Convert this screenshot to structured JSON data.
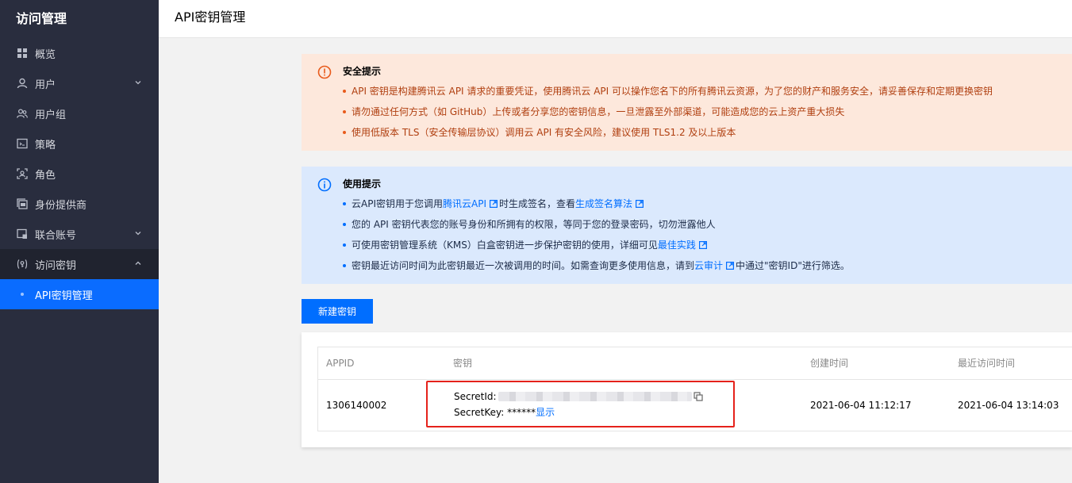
{
  "sidebar": {
    "title": "访问管理",
    "items": [
      {
        "label": "概览",
        "icon": "grid-icon"
      },
      {
        "label": "用户",
        "icon": "user-icon",
        "chevron": "down"
      },
      {
        "label": "用户组",
        "icon": "user-group-icon"
      },
      {
        "label": "策略",
        "icon": "policy-icon"
      },
      {
        "label": "角色",
        "icon": "role-icon"
      },
      {
        "label": "身份提供商",
        "icon": "identity-provider-icon"
      },
      {
        "label": "联合账号",
        "icon": "federated-account-icon",
        "chevron": "down"
      },
      {
        "label": "访问密钥",
        "icon": "access-key-icon",
        "chevron": "up"
      }
    ],
    "sub_item": "API密钥管理"
  },
  "header": {
    "title": "API密钥管理"
  },
  "warning": {
    "title": "安全提示",
    "items": [
      "API 密钥是构建腾讯云 API 请求的重要凭证，使用腾讯云 API 可以操作您名下的所有腾讯云资源，为了您的财产和服务安全，请妥善保存和定期更换密钥",
      "请勿通过任何方式（如 GitHub）上传或者分享您的密钥信息，一旦泄露至外部渠道，可能造成您的云上资产重大损失",
      "使用低版本 TLS（安全传输层协议）调用云 API 有安全风险，建议使用 TLS1.2 及以上版本"
    ],
    "color": "#e85a1b"
  },
  "info": {
    "title": "使用提示",
    "item1": {
      "pre": "云API密钥用于您调用",
      "link1": "腾讯云API",
      "mid": "时生成签名，查看",
      "link2": "生成签名算法"
    },
    "item2": "您的 API 密钥代表您的账号身份和所拥有的权限，等同于您的登录密码，切勿泄露他人",
    "item3": {
      "pre": "可使用密钥管理系统（KMS）白盒密钥进一步保护密钥的使用，详细可见",
      "link": "最佳实践"
    },
    "item4": {
      "pre": "密钥最近访问时间为此密钥最近一次被调用的时间。如需查询更多使用信息，请到",
      "link": "云审计",
      "post": "中通过\"密钥ID\"进行筛选。"
    },
    "color": "#006eff"
  },
  "new_key_button": "新建密钥",
  "table": {
    "headers": {
      "appid": "APPID",
      "key": "密钥",
      "created": "创建时间",
      "last_access": "最近访问时间"
    },
    "row": {
      "appid": "1306140002",
      "secret_id_label": "SecretId:",
      "secret_key_label": "SecretKey:",
      "secret_key_masked": "******",
      "show_link": "显示",
      "created": "2021-06-04 11:12:17",
      "last_access": "2021-06-04 13:14:03"
    }
  }
}
